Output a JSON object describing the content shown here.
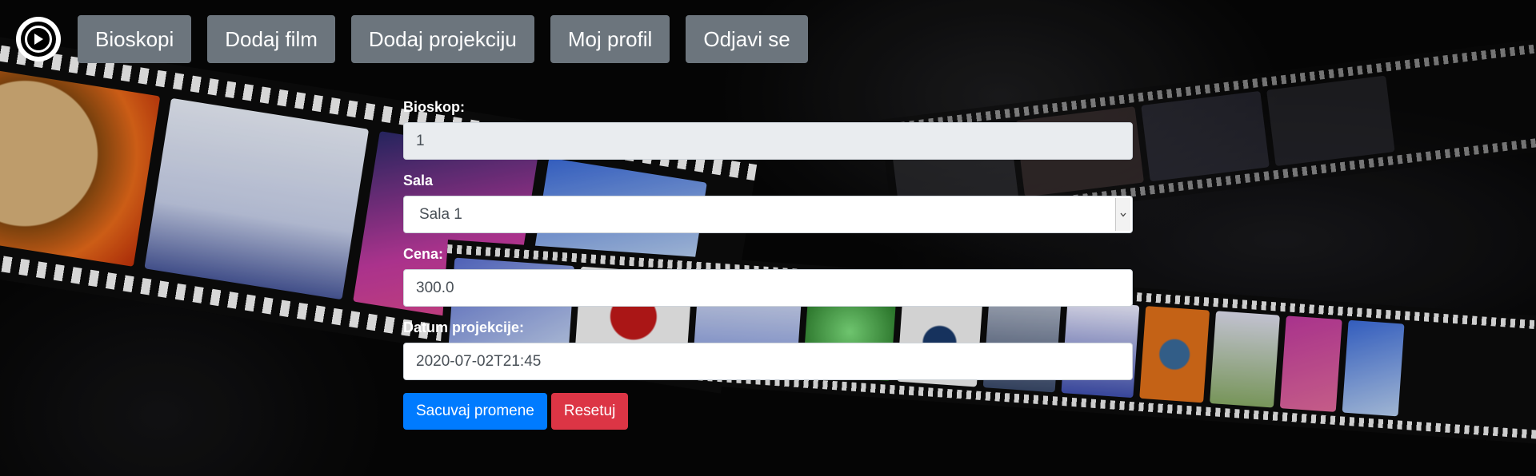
{
  "nav": {
    "logo_icon": "play-circle-icon",
    "items": [
      {
        "label": "Bioskopi"
      },
      {
        "label": "Dodaj film"
      },
      {
        "label": "Dodaj projekciju"
      },
      {
        "label": "Moj profil"
      },
      {
        "label": "Odjavi se"
      }
    ]
  },
  "form": {
    "cinema_label": "Bioskop:",
    "cinema_value": "1",
    "hall_label": "Sala",
    "hall_selected": "Sala 1",
    "price_label": "Cena:",
    "price_value": "300.0",
    "date_label": "Datum projekcije:",
    "date_value": "2020-07-02T21:45",
    "save_label": "Sacuvaj promene",
    "reset_label": "Resetuj"
  },
  "colors": {
    "nav_button": "#6c757d",
    "primary": "#007bff",
    "danger": "#dc3545",
    "readonly_field": "#e9ecef"
  }
}
